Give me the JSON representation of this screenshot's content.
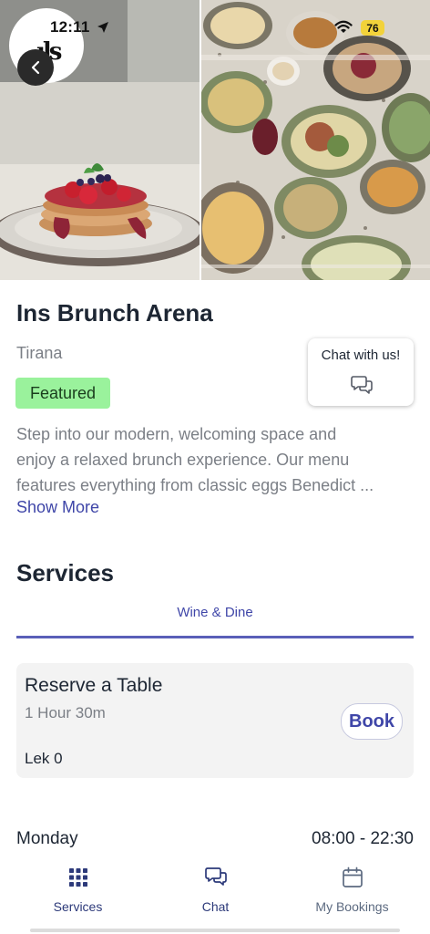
{
  "status_bar": {
    "time": "12:11",
    "battery": "76",
    "battery_color": "#f2d23a"
  },
  "hero": {
    "logo_text": "ıls",
    "back_icon": "chevron-left-icon"
  },
  "venue": {
    "name": "Ins Brunch Arena",
    "city": "Tirana",
    "badge": "Featured",
    "badge_color": "#9af29c",
    "description_lines": [
      "Step into our modern, welcoming space and",
      "enjoy a relaxed brunch experience. Our menu",
      "features everything from classic eggs Benedict ..."
    ],
    "show_more": "Show More"
  },
  "chat_card": {
    "label": "Chat with us!",
    "icon": "chat-bubbles-icon"
  },
  "services": {
    "heading": "Services",
    "tabs": [
      {
        "label": "Wine & Dine",
        "active": true
      }
    ],
    "items": [
      {
        "name": "Reserve a Table",
        "duration": "1 Hour 30m",
        "price": "Lek 0",
        "action": "Book"
      }
    ]
  },
  "hours": {
    "day": "Monday",
    "time": "08:00 - 22:30"
  },
  "bottom_nav": {
    "items": [
      {
        "label": "Services",
        "icon": "grid-icon"
      },
      {
        "label": "Chat",
        "icon": "chat-bubbles-icon"
      },
      {
        "label": "My Bookings",
        "icon": "calendar-icon"
      }
    ]
  },
  "colors": {
    "accent": "#3f46a8",
    "tab_underline": "#5a5fb8",
    "text_primary": "#1d2633",
    "text_secondary": "#7b7f86"
  }
}
